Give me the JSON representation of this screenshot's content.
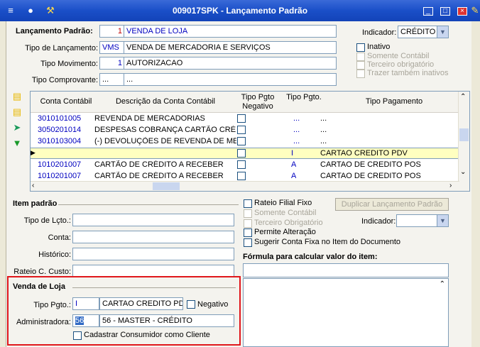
{
  "window": {
    "title": "009017SPK - Lançamento Padrão",
    "toolbar_icons": [
      "exit-icon",
      "traffic-light-icon",
      "wrench-icon"
    ],
    "controls": [
      "minimize-icon",
      "maximize-icon",
      "close-icon",
      "pencil-icon"
    ]
  },
  "header": {
    "lancamento_label": "Lançamento Padrão:",
    "lancamento_code": "1",
    "lancamento_desc": "VENDA DE LOJA",
    "tipo_lancamento_label": "Tipo de Lançamento:",
    "tipo_lancamento_code": "VMS",
    "tipo_lancamento_desc": "VENDA DE MERCADORIA E SERVIÇOS",
    "tipo_movimento_label": "Tipo Movimento:",
    "tipo_movimento_code": "1",
    "tipo_movimento_desc": "AUTORIZACAO",
    "tipo_comprovante_label": "Tipo Comprovante:",
    "tipo_comprovante_code": "...",
    "tipo_comprovante_desc": "...",
    "indicador_label": "Indicador:",
    "indicador_value": "CRÉDITO",
    "inativo_label": "Inativo",
    "somente_contabil_label": "Somente Contábil",
    "terceiro_obrigatorio_label": "Terceiro obrigatório",
    "trazer_inativos_label": "Trazer também inativos"
  },
  "grid": {
    "columns": [
      "Conta Contábil",
      "Descrição da Conta Contábil",
      "Tipo Pgto Negativo",
      "Tipo Pgto.",
      "Tipo Pagamento"
    ],
    "rows": [
      {
        "conta": "3010101005",
        "descricao": "REVENDA DE MERCADORIAS",
        "tipo_pgto": "...",
        "tipo_pagamento": "...",
        "selected": false
      },
      {
        "conta": "3050201014",
        "descricao": "DESPESAS COBRANÇA CARTÃO CRÉDITO",
        "tipo_pgto": "...",
        "tipo_pagamento": "...",
        "selected": false
      },
      {
        "conta": "3010103004",
        "descricao": "(-) DEVOLUÇÕES DE REVENDA DE MERCA",
        "tipo_pgto": "...",
        "tipo_pagamento": "...",
        "selected": false
      },
      {
        "conta": "",
        "descricao": "",
        "tipo_pgto": "I",
        "tipo_pagamento": "CARTAO CREDITO PDV",
        "selected": true
      },
      {
        "conta": "1010201007",
        "descricao": "CARTÃO DE CRÉDITO A RECEBER",
        "tipo_pgto": "A",
        "tipo_pagamento": "CARTAO DE CREDITO POS",
        "selected": false
      },
      {
        "conta": "1010201007",
        "descricao": "CARTÃO DE CRÉDITO A RECEBER",
        "tipo_pgto": "A",
        "tipo_pagamento": "CARTAO DE CREDITO POS",
        "selected": false
      }
    ]
  },
  "item_padrao": {
    "title": "Item padrão",
    "tipo_lcto_label": "Tipo de Lçto.:",
    "conta_label": "Conta:",
    "historico_label": "Histórico:",
    "rateio_label": "Rateio C. Custo:",
    "rateio_filial_fixo_label": "Rateio Filial Fixo",
    "somente_contabil_label": "Somente Contábil",
    "terceiro_obrigatorio_label": "Terceiro Obrigatório",
    "permite_alteracao_label": "Permite Alteração",
    "sugerir_conta_label": "Sugerir Conta Fixa no Item do Documento",
    "duplicar_label": "Duplicar Lançamento Padrão",
    "indicador_label": "Indicador:",
    "formula_label": "Fórmula para calcular valor do item:"
  },
  "venda_loja": {
    "title": "Venda de Loja",
    "tipo_pgto_label": "Tipo Pgto.:",
    "tipo_pgto_code": "I",
    "tipo_pgto_desc": "CARTAO CREDITO PDV",
    "negativo_label": "Negativo",
    "administradora_label": "Administradora:",
    "administradora_code": "56",
    "administradora_desc": "56 - MASTER - CRÉDITO",
    "cadastrar_label": "Cadastrar Consumidor como Cliente"
  },
  "colors": {
    "titlebar": "#1a4fc8",
    "selected_row": "#ffffc0",
    "highlight_box": "#e0161b",
    "link_text": "#0000c0"
  }
}
